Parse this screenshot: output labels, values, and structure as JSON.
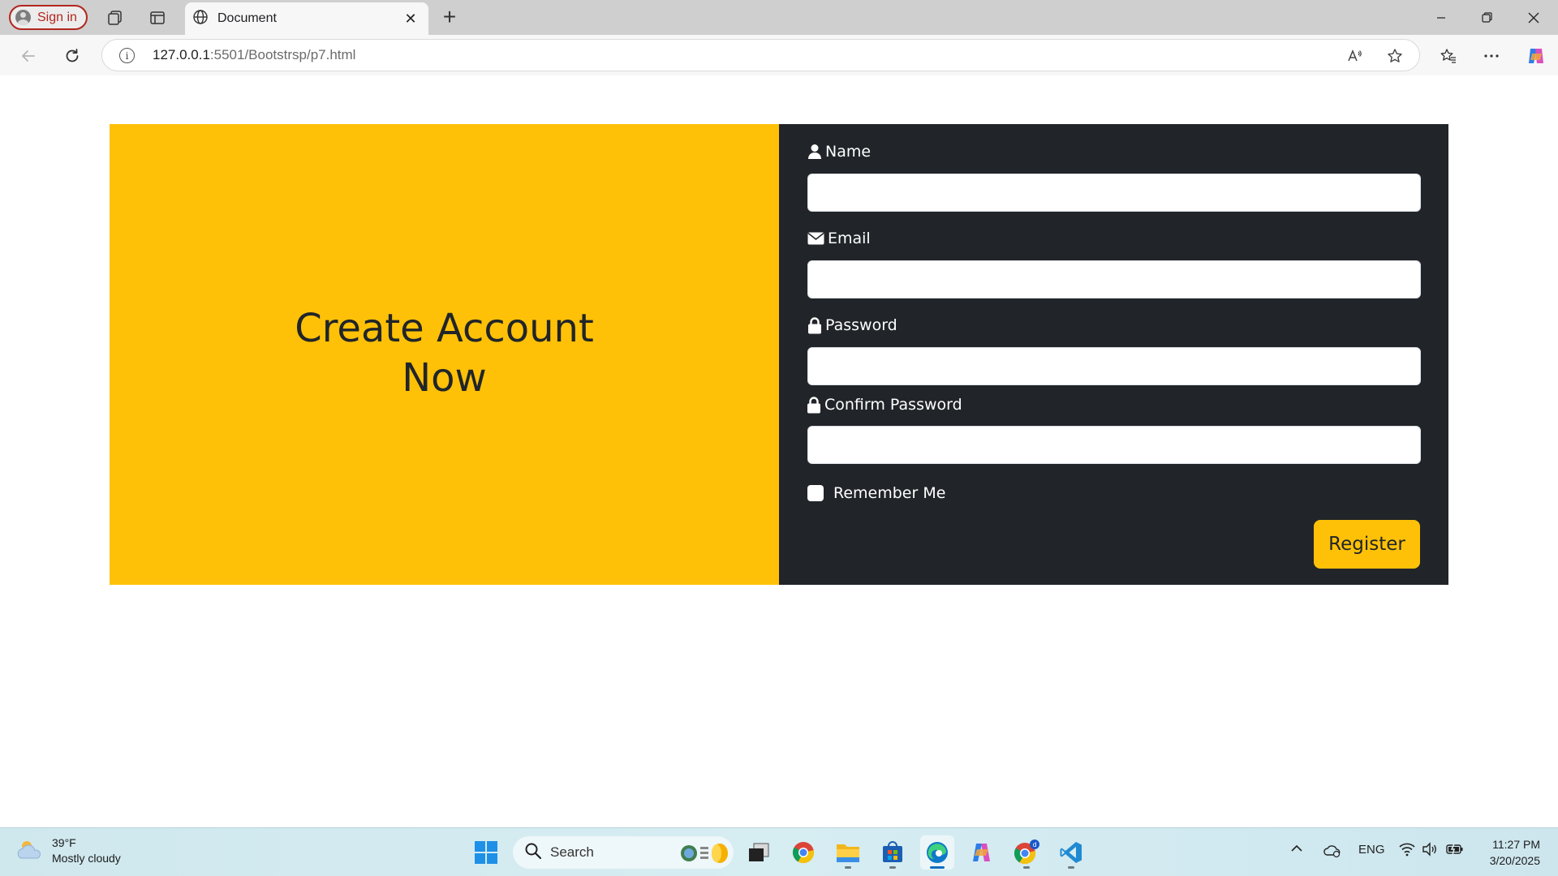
{
  "browser": {
    "signin_label": "Sign in",
    "tab_title": "Document",
    "url_host": "127.0.0.1",
    "url_path": ":5501/Bootstrsp/p7.html"
  },
  "page": {
    "hero_title": "Create Account Now",
    "form": {
      "name_label": "Name",
      "email_label": "Email",
      "password_label": "Password",
      "confirm_label": "Confirm Password",
      "remember_label": "Remember Me",
      "register_label": "Register",
      "name_value": "",
      "email_value": "",
      "password_value": "",
      "confirm_value": "",
      "remember_checked": false
    },
    "colors": {
      "accent": "#ffc107",
      "panel": "#212529"
    }
  },
  "taskbar": {
    "temperature": "39°F",
    "weather": "Mostly cloudy",
    "search_placeholder": "Search",
    "language": "ENG",
    "time": "11:27 PM",
    "date": "3/20/2025"
  }
}
